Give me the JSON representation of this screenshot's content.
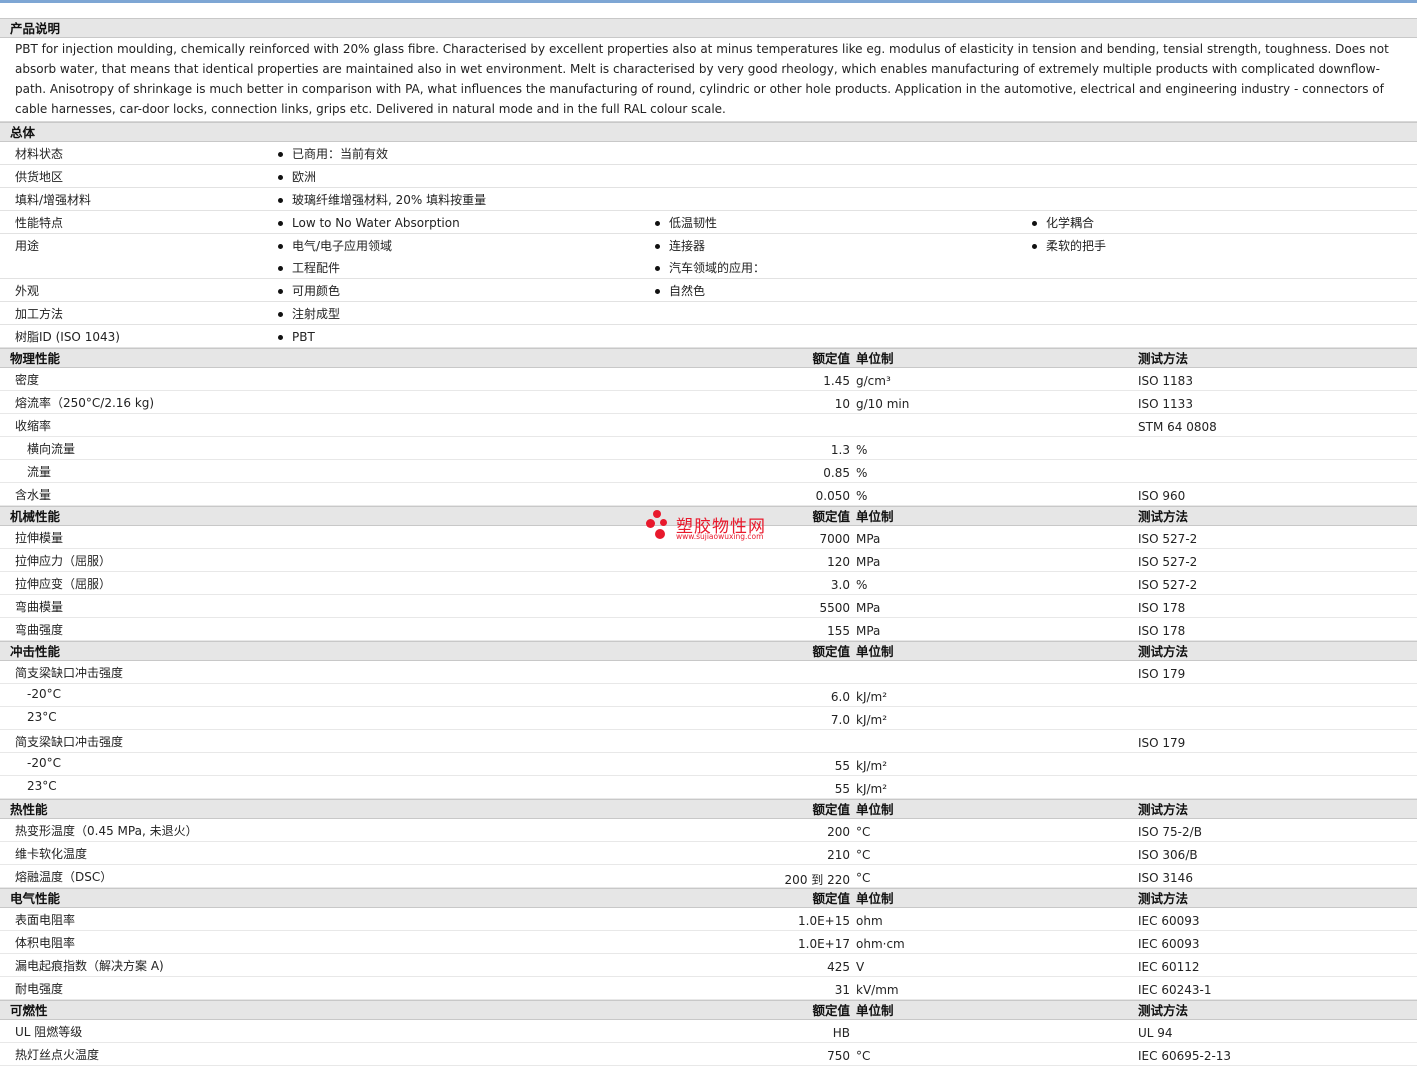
{
  "description": {
    "title": "产品说明",
    "text": "PBT for injection moulding, chemically reinforced with 20% glass fibre. Characterised by excellent properties also at minus temperatures like eg. modulus of elasticity in tension and bending, tensial strength, toughness. Does not absorb water, that means that identical properties are maintained also in wet environment. Melt is characterised by very good rheology, which enables manufacturing of extremely multiple products with complicated downflow-path. Anisotropy of shrinkage is much better in comparison with PA, what influences the manufacturing of round, cylindric or other hole products. Application in the automotive, electrical and engineering industry - connectors of cable harnesses, car-door locks, connection links, grips etc. Delivered in natural mode and in the full RAL colour scale."
  },
  "general": {
    "title": "总体",
    "rows": [
      {
        "label": "材料状态",
        "items": [
          "已商用：当前有效"
        ]
      },
      {
        "label": "供货地区",
        "items": [
          "欧洲"
        ]
      },
      {
        "label": "填料/增强材料",
        "items": [
          "玻璃纤维增强材料, 20% 填料按重量"
        ]
      },
      {
        "label": "性能特点",
        "items": [
          "Low to No Water Absorption",
          "低温韧性",
          "化学耦合"
        ]
      },
      {
        "label": "用途",
        "items": [
          "电气/电子应用领域",
          "连接器",
          "柔软的把手",
          "工程配件",
          "汽车领域的应用："
        ]
      },
      {
        "label": "外观",
        "items": [
          "可用颜色",
          "自然色"
        ]
      },
      {
        "label": "加工方法",
        "items": [
          "注射成型"
        ]
      },
      {
        "label": "树脂ID (ISO 1043)",
        "items": [
          "PBT"
        ]
      }
    ]
  },
  "headers": {
    "value": "额定值",
    "unit": "单位制",
    "method": "测试方法"
  },
  "sections": [
    {
      "title": "物理性能",
      "rows": [
        {
          "label": "密度",
          "value": "1.45",
          "unit": "g/cm³",
          "method": "ISO 1183"
        },
        {
          "label": "熔流率（250°C/2.16 kg)",
          "value": "10",
          "unit": "g/10 min",
          "method": "ISO 1133"
        },
        {
          "label": "收缩率",
          "value": "",
          "unit": "",
          "method": "STM 64 0808"
        },
        {
          "label": "横向流量",
          "value": "1.3",
          "unit": "%",
          "method": "",
          "sub": true
        },
        {
          "label": "流量",
          "value": "0.85",
          "unit": "%",
          "method": "",
          "sub": true
        },
        {
          "label": "含水量",
          "value": "0.050",
          "unit": "%",
          "method": "ISO 960"
        }
      ]
    },
    {
      "title": "机械性能",
      "rows": [
        {
          "label": "拉伸模量",
          "value": "7000",
          "unit": "MPa",
          "method": "ISO 527-2"
        },
        {
          "label": "拉伸应力（屈服）",
          "value": "120",
          "unit": "MPa",
          "method": "ISO 527-2"
        },
        {
          "label": "拉伸应变（屈服）",
          "value": "3.0",
          "unit": "%",
          "method": "ISO 527-2"
        },
        {
          "label": "弯曲模量",
          "value": "5500",
          "unit": "MPa",
          "method": "ISO 178"
        },
        {
          "label": "弯曲强度",
          "value": "155",
          "unit": "MPa",
          "method": "ISO 178"
        }
      ]
    },
    {
      "title": "冲击性能",
      "rows": [
        {
          "label": "简支梁缺口冲击强度",
          "value": "",
          "unit": "",
          "method": "ISO 179"
        },
        {
          "label": "-20°C",
          "value": "6.0",
          "unit": "kJ/m²",
          "method": "",
          "sub": true
        },
        {
          "label": "23°C",
          "value": "7.0",
          "unit": "kJ/m²",
          "method": "",
          "sub": true
        },
        {
          "label": "简支梁缺口冲击强度",
          "value": "",
          "unit": "",
          "method": "ISO 179"
        },
        {
          "label": "-20°C",
          "value": "55",
          "unit": "kJ/m²",
          "method": "",
          "sub": true
        },
        {
          "label": "23°C",
          "value": "55",
          "unit": "kJ/m²",
          "method": "",
          "sub": true
        }
      ]
    },
    {
      "title": "热性能",
      "rows": [
        {
          "label": "热变形温度（0.45 MPa, 未退火）",
          "value": "200",
          "unit": "°C",
          "method": "ISO 75-2/B"
        },
        {
          "label": "维卡软化温度",
          "value": "210",
          "unit": "°C",
          "method": "ISO 306/B"
        },
        {
          "label": "熔融温度（DSC）",
          "value": "200 到 220",
          "unit": "°C",
          "method": "ISO 3146"
        }
      ]
    },
    {
      "title": "电气性能",
      "rows": [
        {
          "label": "表面电阻率",
          "value": "1.0E+15",
          "unit": "ohm",
          "method": "IEC 60093"
        },
        {
          "label": "体积电阻率",
          "value": "1.0E+17",
          "unit": "ohm·cm",
          "method": "IEC 60093"
        },
        {
          "label": "漏电起痕指数（解决方案 A)",
          "value": "425",
          "unit": "V",
          "method": "IEC 60112"
        },
        {
          "label": "耐电强度",
          "value": "31",
          "unit": "kV/mm",
          "method": "IEC 60243-1"
        }
      ]
    },
    {
      "title": "可燃性",
      "rows": [
        {
          "label": "UL 阻燃等级",
          "value": "HB",
          "unit": "",
          "method": "UL 94"
        },
        {
          "label": "热灯丝点火温度",
          "value": "750",
          "unit": "°C",
          "method": "IEC 60695-2-13"
        }
      ]
    }
  ],
  "watermark": {
    "text": "塑胶物性网",
    "url": "www.sujiaowuxing.com"
  },
  "colors": {
    "header_bg": "#e6e6e6",
    "topbar": "#7ea6d4",
    "watermark": "#e8192c"
  }
}
